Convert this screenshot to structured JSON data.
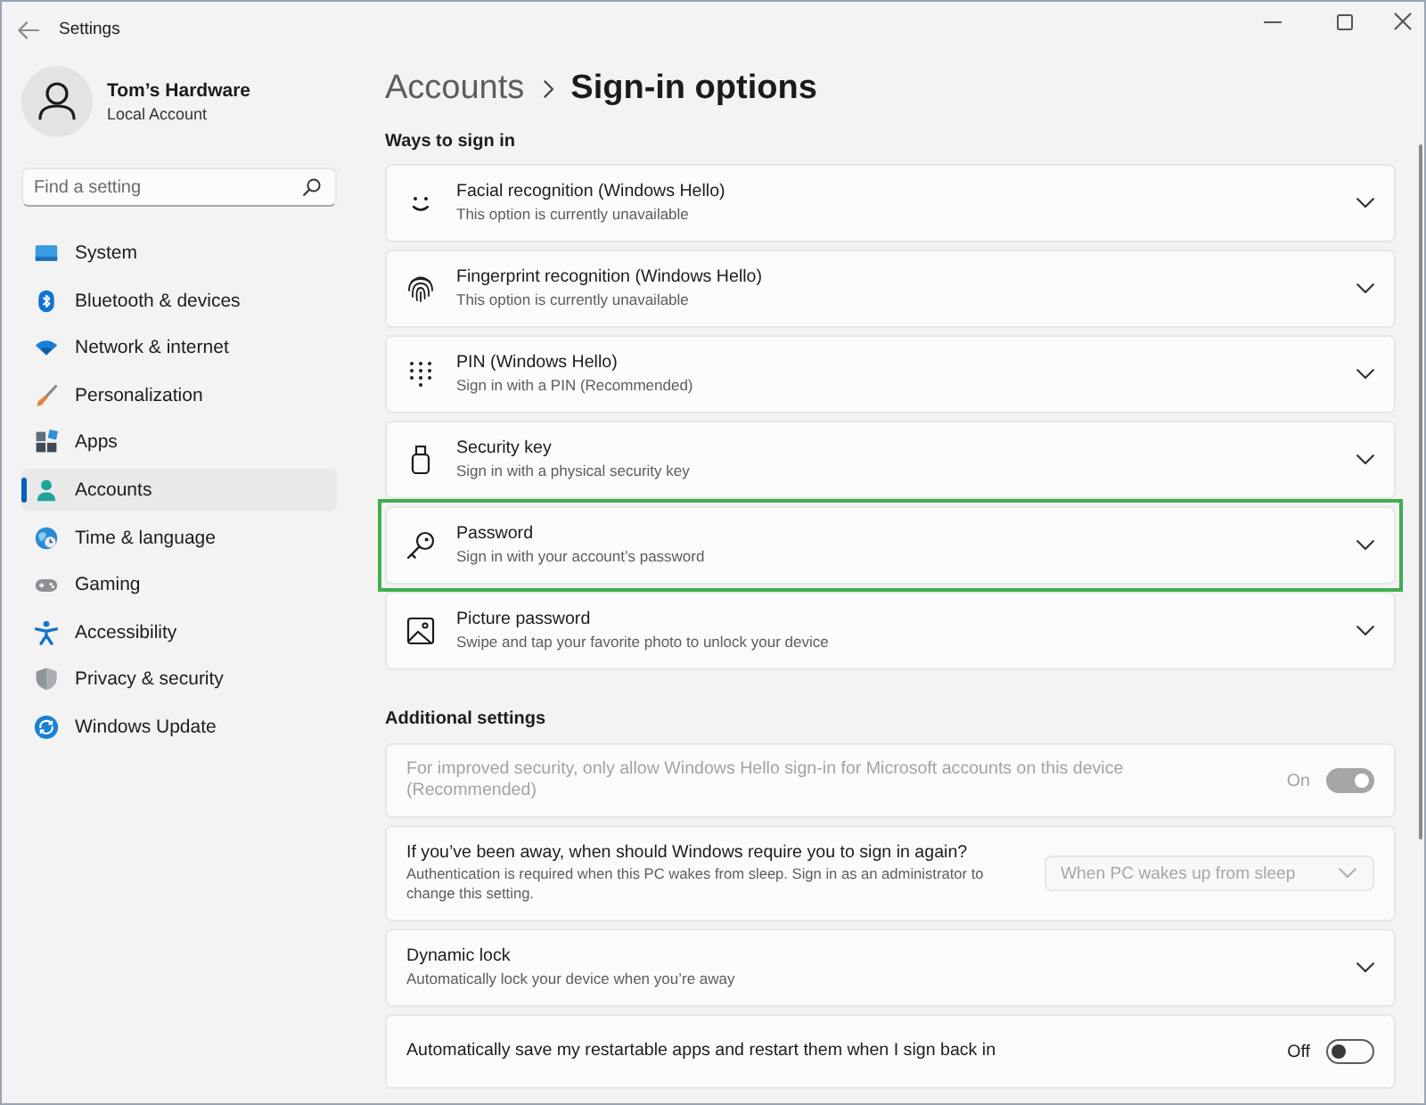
{
  "window": {
    "title": "Settings"
  },
  "profile": {
    "name": "Tom’s Hardware",
    "account_type": "Local Account"
  },
  "search": {
    "placeholder": "Find a setting"
  },
  "sidebar": {
    "items": [
      {
        "label": "System",
        "selected": false
      },
      {
        "label": "Bluetooth & devices",
        "selected": false
      },
      {
        "label": "Network & internet",
        "selected": false
      },
      {
        "label": "Personalization",
        "selected": false
      },
      {
        "label": "Apps",
        "selected": false
      },
      {
        "label": "Accounts",
        "selected": true
      },
      {
        "label": "Time & language",
        "selected": false
      },
      {
        "label": "Gaming",
        "selected": false
      },
      {
        "label": "Accessibility",
        "selected": false
      },
      {
        "label": "Privacy & security",
        "selected": false
      },
      {
        "label": "Windows Update",
        "selected": false
      }
    ]
  },
  "breadcrumb": {
    "parent": "Accounts",
    "current": "Sign-in options"
  },
  "sign_in_methods": {
    "heading": "Ways to sign in",
    "items": [
      {
        "title": "Facial recognition (Windows Hello)",
        "subtitle": "This option is currently unavailable",
        "highlighted": false
      },
      {
        "title": "Fingerprint recognition (Windows Hello)",
        "subtitle": "This option is currently unavailable",
        "highlighted": false
      },
      {
        "title": "PIN (Windows Hello)",
        "subtitle": "Sign in with a PIN (Recommended)",
        "highlighted": false
      },
      {
        "title": "Security key",
        "subtitle": "Sign in with a physical security key",
        "highlighted": false
      },
      {
        "title": "Password",
        "subtitle": "Sign in with your account’s password",
        "highlighted": true
      },
      {
        "title": "Picture password",
        "subtitle": "Swipe and tap your favorite photo to unlock your device",
        "highlighted": false
      }
    ]
  },
  "additional_settings": {
    "heading": "Additional settings",
    "items": [
      {
        "kind": "toggle",
        "title": "For improved security, only allow Windows Hello sign-in for Microsoft accounts on this device (Recommended)",
        "disabled": true,
        "on": true,
        "state_label": "On"
      },
      {
        "kind": "dropdown",
        "title": "If you’ve been away, when should Windows require you to sign in again?",
        "subtitle": "Authentication is required when this PC wakes from sleep. Sign in as an administrator to change this setting.",
        "disabled": false,
        "dropdown": {
          "value": "When PC wakes up from sleep",
          "disabled": true
        }
      },
      {
        "kind": "expander",
        "title": "Dynamic lock",
        "subtitle": "Automatically lock your device when you’re away",
        "disabled": false
      },
      {
        "kind": "toggle",
        "title": "Automatically save my restartable apps and restart them when I sign back in",
        "disabled": false,
        "on": false,
        "state_label": "Off"
      }
    ]
  }
}
